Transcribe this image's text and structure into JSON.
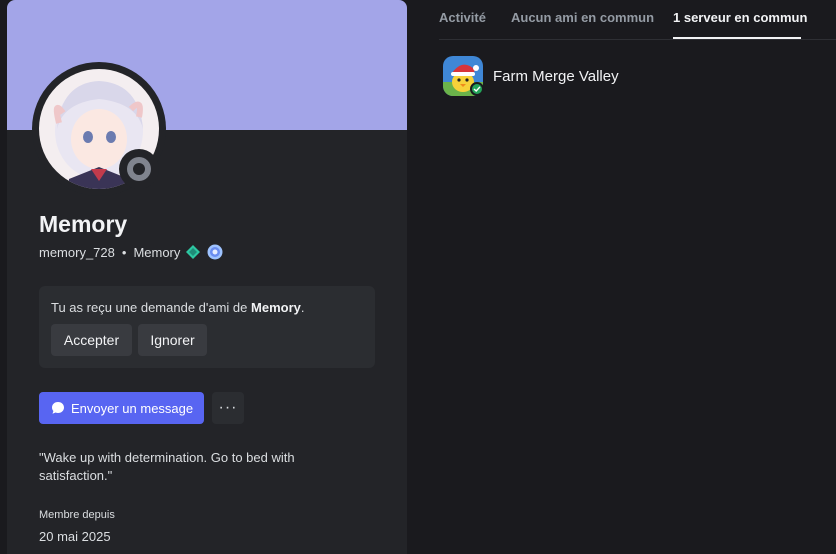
{
  "profile": {
    "banner_color": "#a3a5e8",
    "display_name": "Memory",
    "username": "memory_728",
    "separator": "•",
    "pronoun_tag": "Memory",
    "badges": [
      "hypesquad-gem-badge",
      "nitro-boost-badge"
    ],
    "status": "offline"
  },
  "friend_request": {
    "text_prefix": "Tu as reçu une demande d'ami de ",
    "name": "Memory",
    "text_suffix": ".",
    "accept_label": "Accepter",
    "ignore_label": "Ignorer"
  },
  "actions": {
    "message_label": "Envoyer un message",
    "more_label": "···"
  },
  "bio": "\"Wake up with determination. Go to bed with satisfaction.\"",
  "member_since": {
    "label": "Membre depuis",
    "date": "20 mai 2025"
  },
  "tabs": [
    {
      "label": "Activité",
      "active": false
    },
    {
      "label": "Aucun ami en commun",
      "active": false
    },
    {
      "label": "1 serveur en commun",
      "active": true
    }
  ],
  "servers": [
    {
      "name": "Farm Merge Valley",
      "verified": true
    }
  ],
  "colors": {
    "accent": "#5865f2",
    "verified": "#23a55a"
  }
}
